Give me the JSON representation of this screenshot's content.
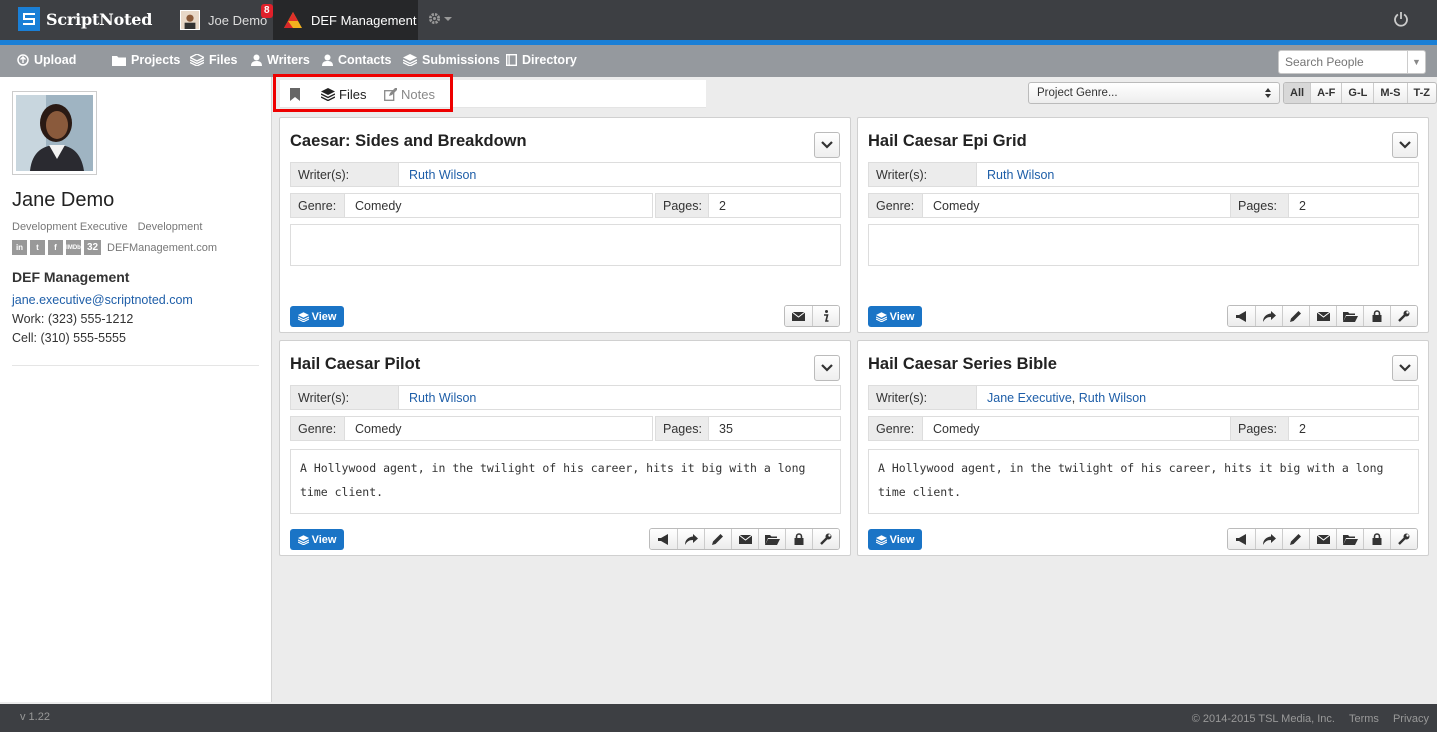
{
  "app": {
    "name": "ScriptNoted",
    "accent": "#1a7fd6"
  },
  "topbar": {
    "user_name": "Joe Demo",
    "notification_count": "8",
    "active_company": "DEF Management"
  },
  "nav": {
    "upload": "Upload",
    "projects": "Projects",
    "files": "Files",
    "writers": "Writers",
    "contacts": "Contacts",
    "submissions": "Submissions",
    "directory": "Directory",
    "search_placeholder": "Search People"
  },
  "profile": {
    "name": "Jane Demo",
    "title": "Development Executive",
    "department": "Development",
    "website": "DEFManagement.com",
    "company": "DEF Management",
    "email": "jane.executive@scriptnoted.com",
    "work_phone": "Work: (323) 555-1212",
    "cell_phone": "Cell: (310) 555-5555",
    "social_icons": [
      "linkedin-icon",
      "twitter-icon",
      "facebook-icon",
      "imdb-icon",
      "thirty-two-icon"
    ]
  },
  "tabs": {
    "files": "Files",
    "notes": "Notes"
  },
  "filter": {
    "genre_select": "Project Genre...",
    "letters": [
      "All",
      "A-F",
      "G-L",
      "M-S",
      "T-Z"
    ],
    "active_letter": "All"
  },
  "labels": {
    "writers": "Writer(s):",
    "genre": "Genre:",
    "pages": "Pages:",
    "view": "View"
  },
  "cards": [
    {
      "title": "Caesar: Sides and Breakdown",
      "writers": "Ruth Wilson",
      "genre": "Comedy",
      "pages": "2",
      "synopsis": ""
    },
    {
      "title": "Hail Caesar Epi Grid",
      "writers": "Ruth Wilson",
      "genre": "Comedy",
      "pages": "2",
      "synopsis": ""
    },
    {
      "title": "Hail Caesar Pilot",
      "writers": "Ruth Wilson",
      "genre": "Comedy",
      "pages": "35",
      "synopsis": "A Hollywood agent, in the twilight of his career, hits it big with a long time client."
    },
    {
      "title": "Hail Caesar Series Bible",
      "writers_a": "Jane Executive",
      "writers_sep": ",",
      "writers_b": "Ruth Wilson",
      "genre": "Comedy",
      "pages": "2",
      "synopsis": "A Hollywood agent, in the twilight of his career, hits it big with a long time client."
    }
  ],
  "footer": {
    "version": "v 1.22",
    "copyright": "© 2014-2015 TSL Media, Inc.",
    "terms": "Terms",
    "privacy": "Privacy"
  }
}
